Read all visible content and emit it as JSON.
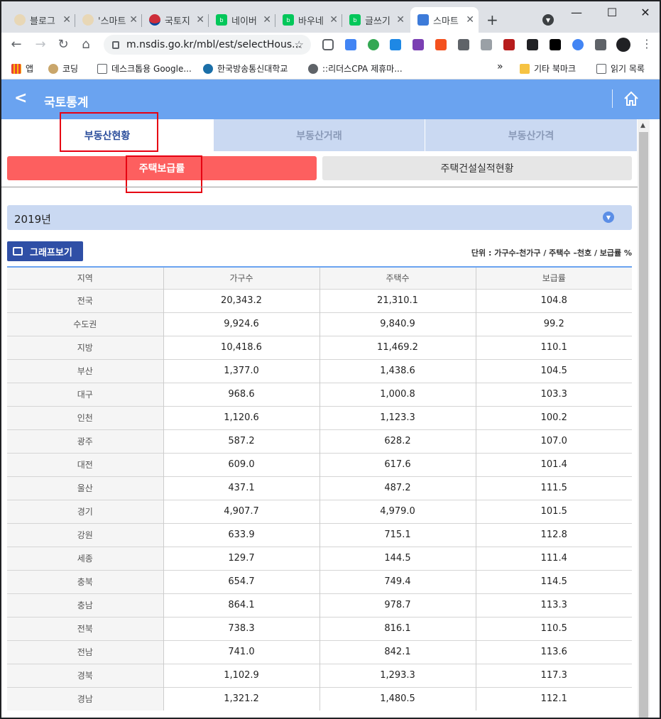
{
  "browser": {
    "tabs": [
      {
        "title": "블로그",
        "favicon_color": "#e8d7b6"
      },
      {
        "title": "'스마트",
        "favicon_color": "#e8d7b6"
      },
      {
        "title": "국토지",
        "favicon_color": "#cd2e3a"
      },
      {
        "title": "네이버",
        "favicon_color": "#03c75a"
      },
      {
        "title": "바우네",
        "favicon_color": "#03c75a"
      },
      {
        "title": "글쓰기",
        "favicon_color": "#03c75a"
      },
      {
        "title": "스마트",
        "favicon_color": "#3d7bd9"
      }
    ],
    "address": "m.nsdis.go.kr/mbl/est/selectHous...",
    "bookmarks": [
      {
        "label": "앱"
      },
      {
        "label": "코딩"
      },
      {
        "label": "데스크톱용 Google..."
      },
      {
        "label": "한국방송통신대학교"
      },
      {
        "label": "::리더스CPA 제휴마..."
      }
    ],
    "other_bookmarks": "기타 북마크",
    "reading_list": "읽기 목록",
    "more_bookmarks": "»"
  },
  "app": {
    "title": "국토통계",
    "main_tabs": [
      "부동산현황",
      "부동산거래",
      "부동산가격"
    ],
    "sub_tabs": [
      "주택보급률",
      "주택건설실적현황"
    ],
    "year": "2019년",
    "graph_button": "그래프보기",
    "unit": "단위 : 가구수-천가구 / 주택수 –천호 / 보급률 %"
  },
  "table": {
    "headers": [
      "지역",
      "가구수",
      "주택수",
      "보급률"
    ],
    "rows": [
      [
        "전국",
        "20,343.2",
        "21,310.1",
        "104.8"
      ],
      [
        "수도권",
        "9,924.6",
        "9,840.9",
        "99.2"
      ],
      [
        "지방",
        "10,418.6",
        "11,469.2",
        "110.1"
      ],
      [
        "부산",
        "1,377.0",
        "1,438.6",
        "104.5"
      ],
      [
        "대구",
        "968.6",
        "1,000.8",
        "103.3"
      ],
      [
        "인천",
        "1,120.6",
        "1,123.3",
        "100.2"
      ],
      [
        "광주",
        "587.2",
        "628.2",
        "107.0"
      ],
      [
        "대전",
        "609.0",
        "617.6",
        "101.4"
      ],
      [
        "울산",
        "437.1",
        "487.2",
        "111.5"
      ],
      [
        "경기",
        "4,907.7",
        "4,979.0",
        "101.5"
      ],
      [
        "강원",
        "633.9",
        "715.1",
        "112.8"
      ],
      [
        "세종",
        "129.7",
        "144.5",
        "111.4"
      ],
      [
        "충북",
        "654.7",
        "749.4",
        "114.5"
      ],
      [
        "충남",
        "864.1",
        "978.7",
        "113.3"
      ],
      [
        "전북",
        "738.3",
        "816.1",
        "110.5"
      ],
      [
        "전남",
        "741.0",
        "842.1",
        "113.6"
      ],
      [
        "경북",
        "1,102.9",
        "1,293.3",
        "117.3"
      ],
      [
        "경남",
        "1,321.2",
        "1,480.5",
        "112.1"
      ]
    ]
  },
  "colors": {
    "appbar": "#6aa3f0",
    "active_sub_tab": "#fd5f5f",
    "highlight_box": "#e60012",
    "graph_button": "#2f4fa6"
  }
}
